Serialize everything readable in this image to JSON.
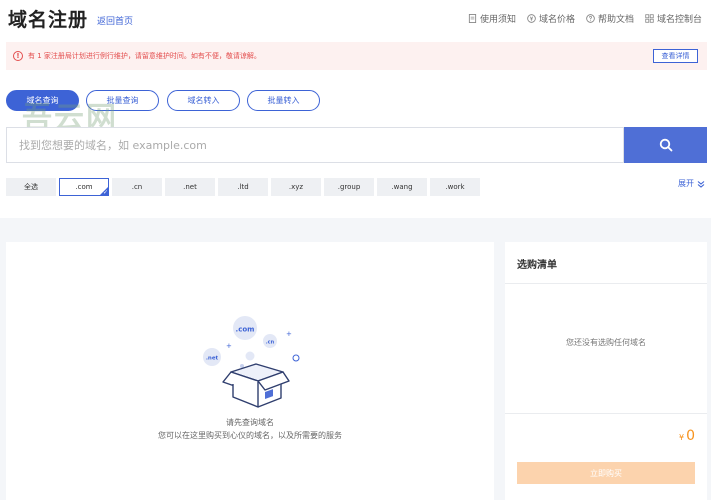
{
  "header": {
    "title": "域名注册",
    "back_link": "返回首页",
    "nav": [
      {
        "label": "使用须知",
        "icon": "document-icon"
      },
      {
        "label": "域名价格",
        "icon": "price-icon"
      },
      {
        "label": "帮助文档",
        "icon": "help-icon"
      },
      {
        "label": "域名控制台",
        "icon": "grid-icon"
      }
    ]
  },
  "notice": {
    "text": "有 1 家注册局计划进行例行维护，请留意维护时间。如有不便，敬请谅解。",
    "detail_button": "查看详情"
  },
  "tabs": [
    {
      "label": "域名查询",
      "active": true
    },
    {
      "label": "批量查询",
      "active": false
    },
    {
      "label": "域名转入",
      "active": false
    },
    {
      "label": "批量转入",
      "active": false
    }
  ],
  "watermark": "吾云网",
  "search": {
    "placeholder": "找到您想要的域名，如 example.com",
    "value": ""
  },
  "suffixes": [
    {
      "label": "全选",
      "selected": false
    },
    {
      "label": ".com",
      "selected": true
    },
    {
      "label": ".cn",
      "selected": false
    },
    {
      "label": ".net",
      "selected": false
    },
    {
      "label": ".ltd",
      "selected": false
    },
    {
      "label": ".xyz",
      "selected": false
    },
    {
      "label": ".group",
      "selected": false
    },
    {
      "label": ".wang",
      "selected": false
    },
    {
      "label": ".work",
      "selected": false
    }
  ],
  "expand_label": "展开",
  "empty_state": {
    "tags": [
      ".com",
      ".cn",
      ".net"
    ],
    "line1": "请先查询域名",
    "line2": "您可以在这里购买到心仪的域名，以及所需要的服务"
  },
  "cart": {
    "title": "选购清单",
    "empty_text": "您还没有选购任何域名",
    "currency": "¥",
    "total": "0",
    "buy_button": "立即购买"
  },
  "colors": {
    "brand": "#3d63d6",
    "search_button": "#4f6fd6",
    "warning": "#e34d4d",
    "price": "#f7931e",
    "buy_disabled": "#fcd3ad"
  }
}
